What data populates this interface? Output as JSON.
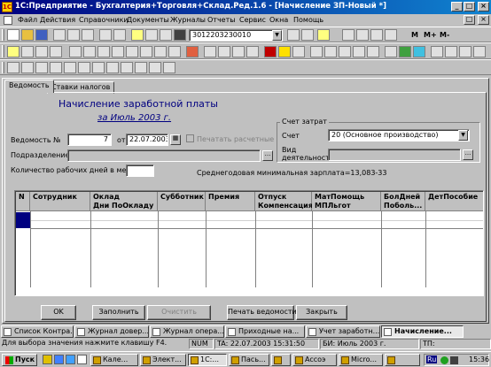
{
  "window": {
    "title": "1С:Предприятие - Бухгалтерия+Торговля+Склад.Ред.1.6 - [Начисление ЗП-Новый *]",
    "app_icon": "1С"
  },
  "menu": [
    "Файл",
    "Действия",
    "Справочники",
    "Документы",
    "Журналы",
    "Отчеты",
    "Сервис",
    "Окна",
    "Помощь"
  ],
  "toolbar": {
    "search_value": "3012203230010",
    "m_label": "M",
    "mplus_label": "M+",
    "mminus_label": "M-"
  },
  "tabs": [
    "Ведомость",
    "Ставки налогов"
  ],
  "form": {
    "title": "Начисление заработной платы",
    "period": "за Июль 2003 г.",
    "vedomost_label": "Ведомость №",
    "vedomost_number": "7",
    "date_from_label": "от",
    "date_value": "22.07.2003",
    "print_checkbox_label": "Печатать расчетные",
    "podrazdelenie_label": "Подразделение",
    "workdays_label": "Количество рабочих дней в месяце",
    "min_wage_text": "Среднегодовая минимальная зарплата=13,083-33",
    "cost_group_label": "Счет затрат",
    "schet_label": "Счет",
    "schet_value": "20 (Основное производство)",
    "vid_label": "Вид",
    "vid_label2": "деятельности"
  },
  "grid": {
    "columns": [
      {
        "top": "N",
        "bottom": ""
      },
      {
        "top": "Сотрудник",
        "bottom": ""
      },
      {
        "top": "Оклад",
        "bottom": "Дни",
        "bottom2": "ПоОкладу"
      },
      {
        "top": "Субботник",
        "bottom": ""
      },
      {
        "top": "Премия",
        "bottom": ""
      },
      {
        "top": "Отпуск",
        "bottom": "Компенсация"
      },
      {
        "top": "МатПомощь",
        "bottom": "МПЛьгот"
      },
      {
        "top": "БолДней",
        "bottom": "Поболь..."
      },
      {
        "top": "ДетПособие",
        "bottom": ""
      }
    ]
  },
  "buttons": {
    "ok": "OK",
    "fill": "Заполнить",
    "clear": "Очистить",
    "print": "Печать ведомости",
    "close": "Закрыть"
  },
  "window_tabs": [
    "Список Контра...",
    "Журнал довер...",
    "Журнал опера...",
    "Приходные на...",
    "Учет заработн...",
    "Начисление..."
  ],
  "status": {
    "hint": "Для выбора значения нажмите клавишу F4.",
    "num": "NUM",
    "ta": "TA: 22.07.2003   15:31:50",
    "bi": "БИ: Июль 2003 г.",
    "tp": "ТП:"
  },
  "taskbar": {
    "start": "Пуск",
    "items": [
      "Кале...",
      "Элект...",
      "1С:...",
      "Пась...",
      "",
      "Accoэ",
      "Micro...",
      ""
    ],
    "lang": "Ru",
    "clock": "15:36"
  },
  "colors": {
    "title_start": "#000080",
    "title_end": "#1084d0",
    "form_title": "#000080",
    "chrome": "#c0c0c0",
    "grid_cursor": "#000080"
  }
}
